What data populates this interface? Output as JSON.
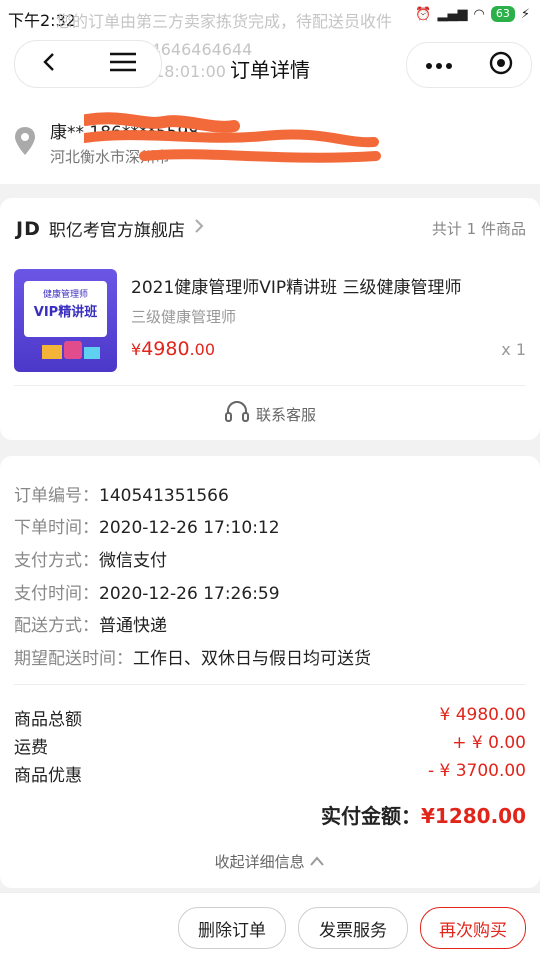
{
  "status_bar": {
    "time": "下午2:32",
    "signal": "📶",
    "battery": "63"
  },
  "ghost_banner": {
    "line1": "您的订单由第三方卖家拣货完成，待配送员收件",
    "line2": "运单号为9734646464644",
    "line3": "2020-12-26 18:01:00"
  },
  "header": {
    "title": "订单详情"
  },
  "address": {
    "name": "康**  186****5598",
    "detail": "河北衡水市深州市***********"
  },
  "shop": {
    "logo": "JD",
    "name": "职亿考官方旗舰店",
    "count": "共计 1 件商品"
  },
  "product": {
    "thumb_line1": "健康管理师",
    "thumb_line2": "VIP精讲班",
    "name": "2021健康管理师VIP精讲班 三级健康管理师",
    "sub": "三级健康管理师",
    "price_symbol": "¥",
    "price_int": "4980",
    "price_dec": ".00",
    "qty": "x 1"
  },
  "service": {
    "label": "联系客服"
  },
  "order_info": [
    {
      "label": "订单编号：",
      "value": "140541351566"
    },
    {
      "label": "下单时间：",
      "value": "2020-12-26 17:10:12"
    },
    {
      "label": "支付方式：",
      "value": "微信支付"
    },
    {
      "label": "支付时间：",
      "value": "2020-12-26 17:26:59"
    },
    {
      "label": "配送方式：",
      "value": "普通快递"
    },
    {
      "label": "期望配送时间：",
      "value": "工作日、双休日与假日均可送货"
    }
  ],
  "costs": [
    {
      "label": "商品总额",
      "value": "¥ 4980.00"
    },
    {
      "label": "运费",
      "value": "+ ¥ 0.00"
    },
    {
      "label": "商品优惠",
      "value": "- ¥ 3700.00"
    }
  ],
  "paid": {
    "label": "实付金额：",
    "amount": "¥1280.00"
  },
  "collapse": {
    "label": "收起详细信息"
  },
  "actions": {
    "delete": "删除订单",
    "invoice": "发票服务",
    "rebuy": "再次购买"
  },
  "colors": {
    "accent": "#e1251b",
    "battery": "#2bb04a",
    "scribble": "#f26a3a"
  }
}
